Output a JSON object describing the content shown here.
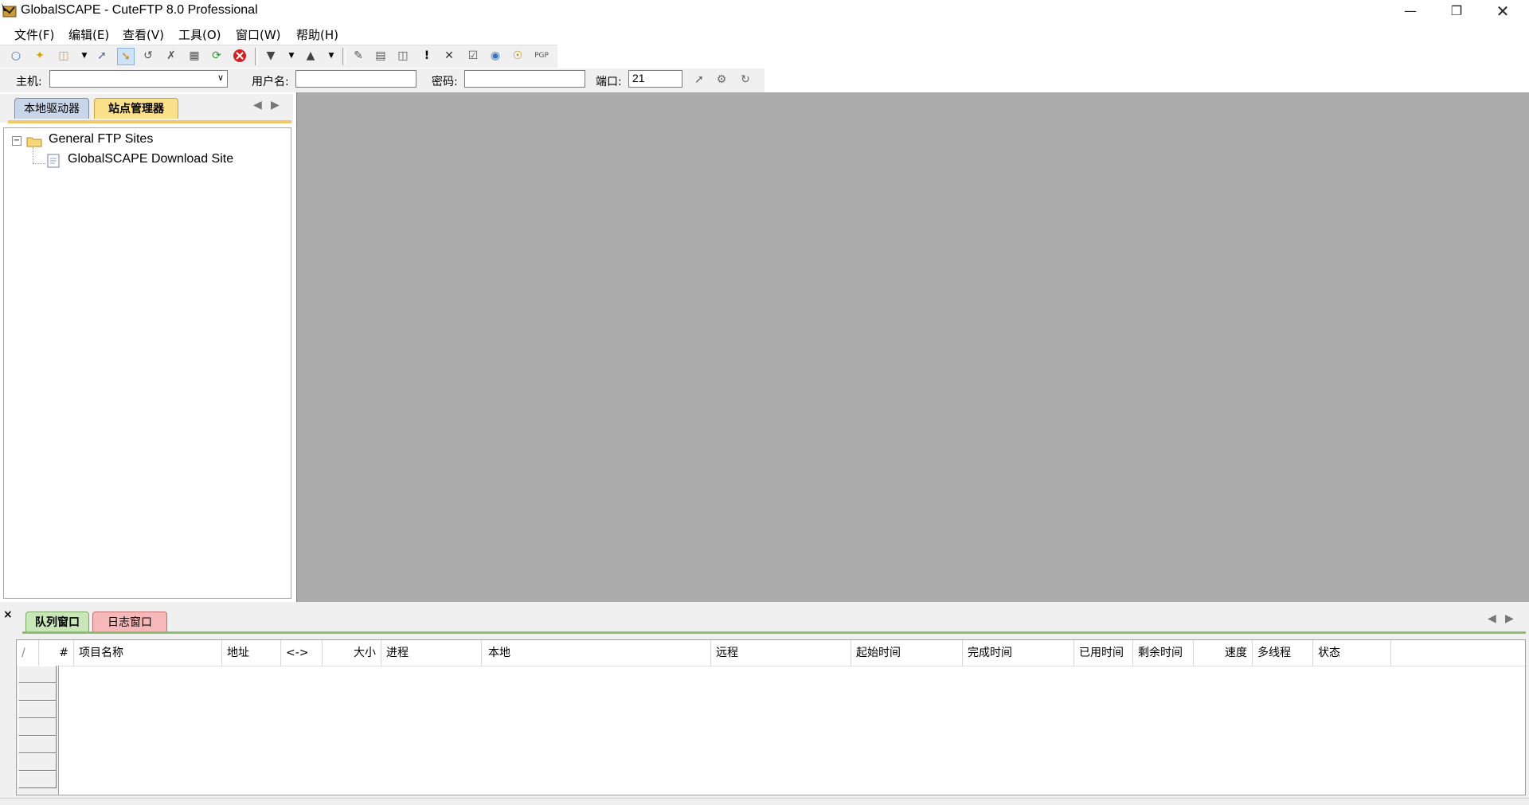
{
  "window": {
    "title": "GlobalSCAPE - CuteFTP 8.0 Professional"
  },
  "menu": [
    "文件(F)",
    "编辑(E)",
    "查看(V)",
    "工具(O)",
    "窗口(W)",
    "帮助(H)"
  ],
  "quickconnect": {
    "host_label": "主机:",
    "host_value": "",
    "user_label": "用户名:",
    "user_value": "",
    "password_label": "密码:",
    "password_value": "",
    "port_label": "端口:",
    "port_value": "21"
  },
  "left_tabs": [
    "本地驱动器",
    "站点管理器"
  ],
  "tree": {
    "root": "General FTP Sites",
    "child": "GlobalSCAPE Download Site"
  },
  "bottom_tabs": [
    "队列窗口",
    "日志窗口"
  ],
  "queue_columns": [
    "/",
    "#",
    "项目名称",
    "地址",
    "<->",
    "大小",
    "进程",
    "本地",
    "远程",
    "起始时间",
    "完成时间",
    "已用时间",
    "剩余时间",
    "速度",
    "多线程",
    "状态"
  ],
  "close_glyph": "×",
  "colors": {
    "mdi_background": "#ababab",
    "site_tab": "#f9e08b",
    "queue_tab": "#c9e6b8",
    "log_tab": "#f6b8b8"
  }
}
